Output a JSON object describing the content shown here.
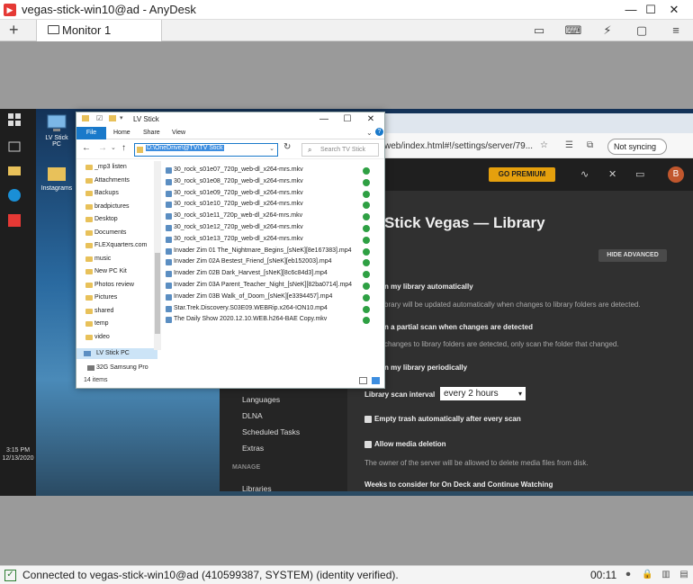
{
  "anydesk": {
    "title": "vegas-stick-win10@ad - AnyDesk",
    "logo": "▶",
    "window_buttons": {
      "minimize": "—",
      "maximize": "☐",
      "close": "✕"
    },
    "tab_plus": "+",
    "tab_label": "Monitor 1",
    "toolbar_icons": [
      "chat-icon",
      "keyboard-icon",
      "action-icon",
      "display-icon",
      "menu-icon"
    ],
    "status_text": "Connected to vegas-stick-win10@ad (410599387, SYSTEM) (identity verified).",
    "timer": "00:11",
    "check": "✓"
  },
  "desktop": {
    "icons": [
      {
        "label": "LV Stick PC"
      },
      {
        "label": "Instagrams"
      }
    ],
    "clock_time": "3:15 PM",
    "clock_date": "12/13/2020"
  },
  "browser": {
    "url": "web/index.html#!/settings/server/79...",
    "sync_label": "Not syncing"
  },
  "plex": {
    "go_premium": "GO PREMIUM",
    "avatar": "B",
    "title": "Stick Vegas — Library",
    "hide_advanced": "HIDE ADVANCED",
    "settings": [
      {
        "bold": "n my library automatically",
        "sub": "brary will be updated automatically when changes to library folders are detected."
      },
      {
        "bold": "n a partial scan when changes are detected",
        "sub": "changes to library folders are detected, only scan the folder that changed."
      },
      {
        "bold": "n my library periodically",
        "sub": ""
      }
    ],
    "scan_interval_label": "Library scan interval",
    "scan_interval_value": "every 2 hours",
    "empty_trash": "Empty trash automatically after every scan",
    "allow_deletion": "Allow media deletion",
    "allow_deletion_sub": "The owner of the server will be allowed to delete media files from disk.",
    "weeks_label": "Weeks to consider for On Deck and Continue Watching",
    "sidebar": [
      "Languages",
      "DLNA",
      "Scheduled Tasks",
      "Extras"
    ],
    "sidebar_section": "MANAGE",
    "sidebar_last": "Libraries"
  },
  "explorer": {
    "title": "LV Stick",
    "ribbon": [
      "File",
      "Home",
      "Share",
      "View"
    ],
    "address": "D:\\OneDrive\\@TV\\TV Stick",
    "search_placeholder": "Search TV Stick",
    "nav": [
      "_mp3 listen",
      "Attachments",
      "Backups",
      "bradpictures",
      "Desktop",
      "Documents",
      "FLEXquarters.com",
      "music",
      "New PC Kit",
      "Photos review",
      "Pictures",
      "shared",
      "temp",
      "video"
    ],
    "nav_selected": "LV Stick PC",
    "nav_drive": "32G Samsung Pro",
    "files": [
      "30_rock_s01e07_720p_web-dl_x264-mrs.mkv",
      "30_rock_s01e08_720p_web-dl_x264-mrs.mkv",
      "30_rock_s01e09_720p_web-dl_x264-mrs.mkv",
      "30_rock_s01e10_720p_web-dl_x264-mrs.mkv",
      "30_rock_s01e11_720p_web-dl_x264-mrs.mkv",
      "30_rock_s01e12_720p_web-dl_x264-mrs.mkv",
      "30_rock_s01e13_720p_web-dl_x264-mrs.mkv",
      "Invader Zim 01 The_Nightmare_Begins_[sNeK][8e167383].mp4",
      "Invader Zim 02A Bestest_Friend_[sNeK][eb152003].mp4",
      "Invader Zim 02B Dark_Harvest_[sNeK][8c6c84d3].mp4",
      "Invader Zim 03A Parent_Teacher_Night_[sNeK][82ba0714].mp4",
      "Invader Zim 03B Walk_of_Doom_[sNeK][e3394457].mp4",
      "Star.Trek.Discovery.S03E09.WEBRip.x264-ION10.mp4",
      "The Daily Show 2020.12.10.WEB.h264-BAE Copy.mkv"
    ],
    "status": "14 items",
    "check_icon": "sync-ok-icon"
  }
}
